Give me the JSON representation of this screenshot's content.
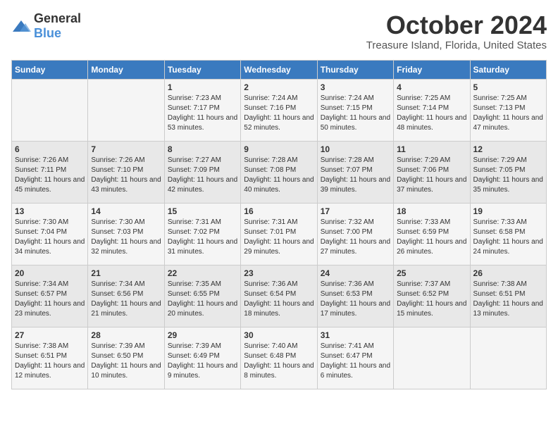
{
  "logo": {
    "general": "General",
    "blue": "Blue"
  },
  "title": "October 2024",
  "location": "Treasure Island, Florida, United States",
  "days_of_week": [
    "Sunday",
    "Monday",
    "Tuesday",
    "Wednesday",
    "Thursday",
    "Friday",
    "Saturday"
  ],
  "weeks": [
    [
      {
        "day": "",
        "info": ""
      },
      {
        "day": "",
        "info": ""
      },
      {
        "day": "1",
        "info": "Sunrise: 7:23 AM\nSunset: 7:17 PM\nDaylight: 11 hours and 53 minutes."
      },
      {
        "day": "2",
        "info": "Sunrise: 7:24 AM\nSunset: 7:16 PM\nDaylight: 11 hours and 52 minutes."
      },
      {
        "day": "3",
        "info": "Sunrise: 7:24 AM\nSunset: 7:15 PM\nDaylight: 11 hours and 50 minutes."
      },
      {
        "day": "4",
        "info": "Sunrise: 7:25 AM\nSunset: 7:14 PM\nDaylight: 11 hours and 48 minutes."
      },
      {
        "day": "5",
        "info": "Sunrise: 7:25 AM\nSunset: 7:13 PM\nDaylight: 11 hours and 47 minutes."
      }
    ],
    [
      {
        "day": "6",
        "info": "Sunrise: 7:26 AM\nSunset: 7:11 PM\nDaylight: 11 hours and 45 minutes."
      },
      {
        "day": "7",
        "info": "Sunrise: 7:26 AM\nSunset: 7:10 PM\nDaylight: 11 hours and 43 minutes."
      },
      {
        "day": "8",
        "info": "Sunrise: 7:27 AM\nSunset: 7:09 PM\nDaylight: 11 hours and 42 minutes."
      },
      {
        "day": "9",
        "info": "Sunrise: 7:28 AM\nSunset: 7:08 PM\nDaylight: 11 hours and 40 minutes."
      },
      {
        "day": "10",
        "info": "Sunrise: 7:28 AM\nSunset: 7:07 PM\nDaylight: 11 hours and 39 minutes."
      },
      {
        "day": "11",
        "info": "Sunrise: 7:29 AM\nSunset: 7:06 PM\nDaylight: 11 hours and 37 minutes."
      },
      {
        "day": "12",
        "info": "Sunrise: 7:29 AM\nSunset: 7:05 PM\nDaylight: 11 hours and 35 minutes."
      }
    ],
    [
      {
        "day": "13",
        "info": "Sunrise: 7:30 AM\nSunset: 7:04 PM\nDaylight: 11 hours and 34 minutes."
      },
      {
        "day": "14",
        "info": "Sunrise: 7:30 AM\nSunset: 7:03 PM\nDaylight: 11 hours and 32 minutes."
      },
      {
        "day": "15",
        "info": "Sunrise: 7:31 AM\nSunset: 7:02 PM\nDaylight: 11 hours and 31 minutes."
      },
      {
        "day": "16",
        "info": "Sunrise: 7:31 AM\nSunset: 7:01 PM\nDaylight: 11 hours and 29 minutes."
      },
      {
        "day": "17",
        "info": "Sunrise: 7:32 AM\nSunset: 7:00 PM\nDaylight: 11 hours and 27 minutes."
      },
      {
        "day": "18",
        "info": "Sunrise: 7:33 AM\nSunset: 6:59 PM\nDaylight: 11 hours and 26 minutes."
      },
      {
        "day": "19",
        "info": "Sunrise: 7:33 AM\nSunset: 6:58 PM\nDaylight: 11 hours and 24 minutes."
      }
    ],
    [
      {
        "day": "20",
        "info": "Sunrise: 7:34 AM\nSunset: 6:57 PM\nDaylight: 11 hours and 23 minutes."
      },
      {
        "day": "21",
        "info": "Sunrise: 7:34 AM\nSunset: 6:56 PM\nDaylight: 11 hours and 21 minutes."
      },
      {
        "day": "22",
        "info": "Sunrise: 7:35 AM\nSunset: 6:55 PM\nDaylight: 11 hours and 20 minutes."
      },
      {
        "day": "23",
        "info": "Sunrise: 7:36 AM\nSunset: 6:54 PM\nDaylight: 11 hours and 18 minutes."
      },
      {
        "day": "24",
        "info": "Sunrise: 7:36 AM\nSunset: 6:53 PM\nDaylight: 11 hours and 17 minutes."
      },
      {
        "day": "25",
        "info": "Sunrise: 7:37 AM\nSunset: 6:52 PM\nDaylight: 11 hours and 15 minutes."
      },
      {
        "day": "26",
        "info": "Sunrise: 7:38 AM\nSunset: 6:51 PM\nDaylight: 11 hours and 13 minutes."
      }
    ],
    [
      {
        "day": "27",
        "info": "Sunrise: 7:38 AM\nSunset: 6:51 PM\nDaylight: 11 hours and 12 minutes."
      },
      {
        "day": "28",
        "info": "Sunrise: 7:39 AM\nSunset: 6:50 PM\nDaylight: 11 hours and 10 minutes."
      },
      {
        "day": "29",
        "info": "Sunrise: 7:39 AM\nSunset: 6:49 PM\nDaylight: 11 hours and 9 minutes."
      },
      {
        "day": "30",
        "info": "Sunrise: 7:40 AM\nSunset: 6:48 PM\nDaylight: 11 hours and 8 minutes."
      },
      {
        "day": "31",
        "info": "Sunrise: 7:41 AM\nSunset: 6:47 PM\nDaylight: 11 hours and 6 minutes."
      },
      {
        "day": "",
        "info": ""
      },
      {
        "day": "",
        "info": ""
      }
    ]
  ]
}
